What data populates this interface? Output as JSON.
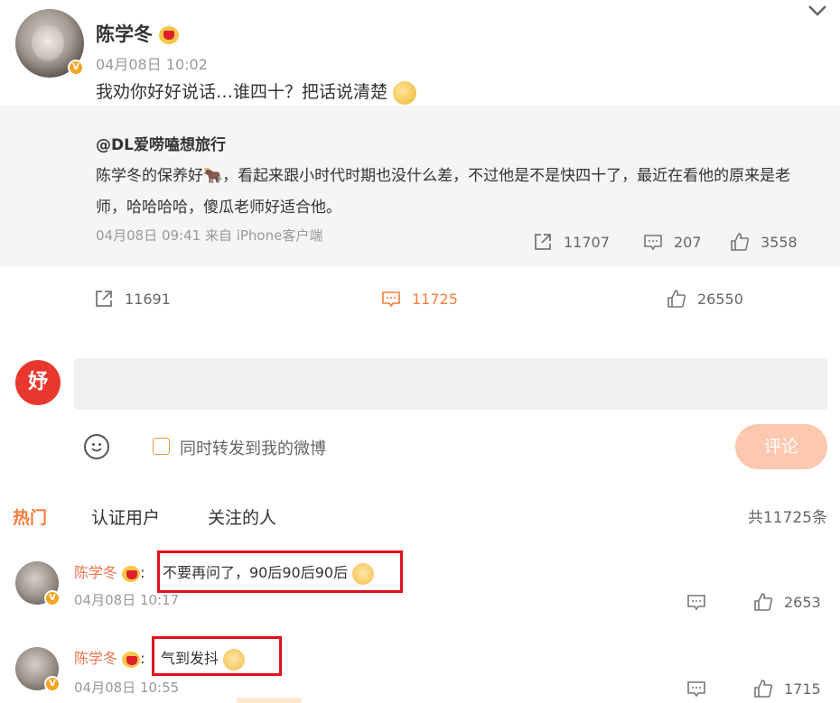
{
  "post": {
    "author": "陈学冬",
    "time": "04月08日 10:02",
    "text": "我劝你好好说话…谁四十？把话说清楚",
    "verified_badge": "V"
  },
  "repost": {
    "user": "@DL爱唠嗑想旅行",
    "text": "陈学冬的保养好🐂，看起来跟小时代时期也没什么差，不过他是不是快四十了，最近在看他的原来是老师，哈哈哈哈，傻瓜老师好适合他。",
    "meta": "04月08日 09:41 来自 iPhone客户端",
    "reposts": "11707",
    "comments": "207",
    "likes": "3558"
  },
  "actions": {
    "reposts": "11691",
    "comments": "11725",
    "likes": "26550"
  },
  "composer": {
    "forward_label": "同时转发到我的微博",
    "submit_label": "评论",
    "my_avatar_text": "妤"
  },
  "tabs": [
    {
      "label": "热门"
    },
    {
      "label": "认证用户"
    },
    {
      "label": "关注的人"
    }
  ],
  "total_comments": "共11725条",
  "comments": [
    {
      "name": "陈学冬",
      "text": "不要再问了，90后90后90后",
      "time": "04月08日 10:17",
      "likes": "2653"
    },
    {
      "name": "陈学冬",
      "text": "气到发抖",
      "time": "04月08日 10:55",
      "likes": "1715"
    }
  ],
  "colors": {
    "accent": "#fa7d3c",
    "name_color": "#eb7350",
    "highlight_box": "#e0101a",
    "submit_bg": "#fcc8b0"
  }
}
